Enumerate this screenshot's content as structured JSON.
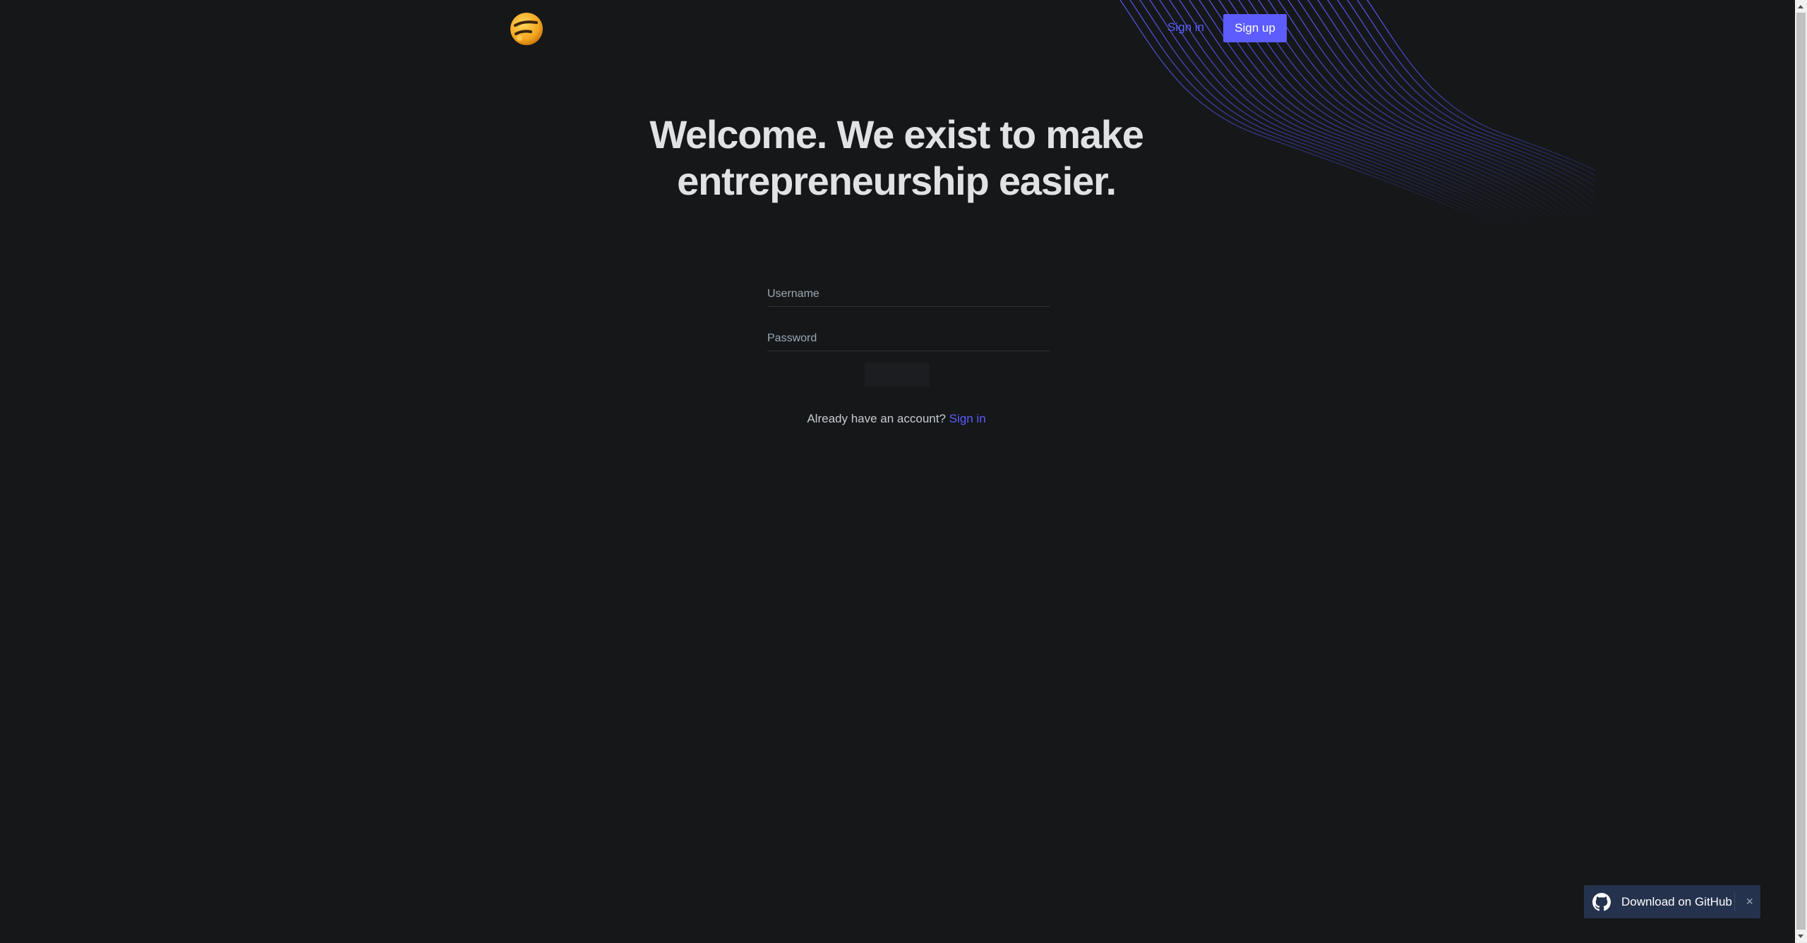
{
  "header": {
    "logo_icon": "emoji-face-logo-icon",
    "signin_label": "Sign in",
    "signup_label": "Sign up"
  },
  "hero": {
    "line1": "Welcome. We exist to make",
    "line2": "entrepreneurship easier."
  },
  "form": {
    "username_placeholder": "Username",
    "password_placeholder": "Password",
    "account_prompt": "Already have an account?",
    "account_link": "Sign in"
  },
  "github_banner": {
    "icon": "github-icon",
    "label": "Download on GitHub",
    "close_symbol": "×"
  },
  "colors": {
    "background": "#151719",
    "accent": "#5d5dff",
    "banner": "#24324d"
  }
}
